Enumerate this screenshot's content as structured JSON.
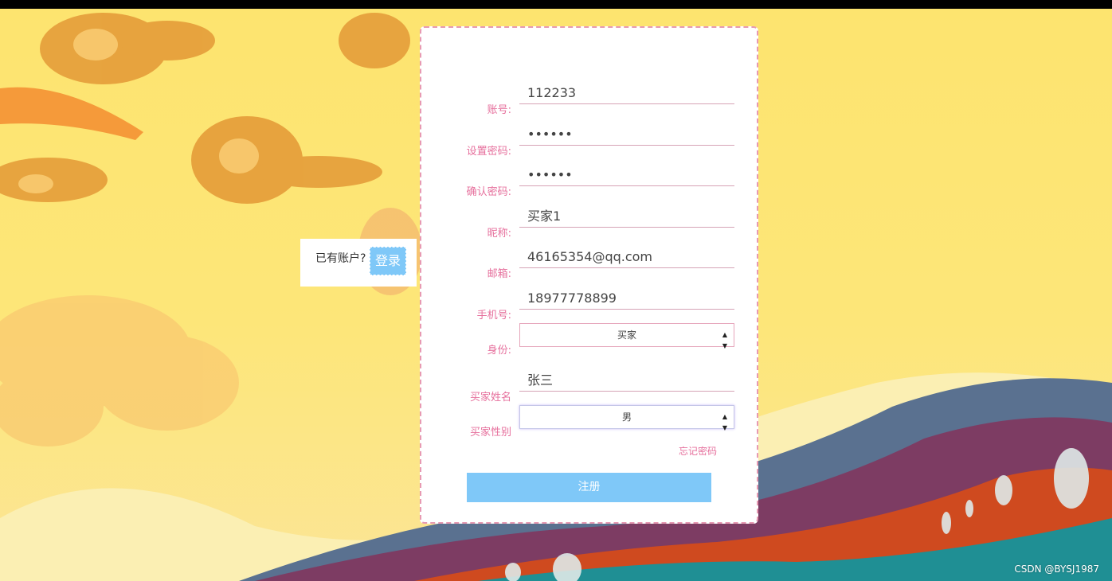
{
  "login_prompt": {
    "text": "已有账户?",
    "button": "登录"
  },
  "form": {
    "account": {
      "label": "账号:",
      "value": "112233"
    },
    "password": {
      "label": "设置密码:",
      "value": "••••••"
    },
    "confirm": {
      "label": "确认密码:",
      "value": "••••••"
    },
    "nickname": {
      "label": "昵称:",
      "value": "买家1"
    },
    "email": {
      "label": "邮箱:",
      "value": "46165354@qq.com"
    },
    "phone": {
      "label": "手机号:",
      "value": "18977778899"
    },
    "identity": {
      "label": "身份:",
      "value": "买家"
    },
    "buyer_name": {
      "label": "买家姓名",
      "value": "张三"
    },
    "buyer_gender": {
      "label": "买家性别",
      "value": "男"
    },
    "forgot_link": "忘记密码",
    "register_button": "注册"
  },
  "watermark": "CSDN @BYSJ1987",
  "colors": {
    "accent_pink": "#e66f9c",
    "button_blue": "#7fc8f8",
    "background_yellow": "#fde46f"
  }
}
